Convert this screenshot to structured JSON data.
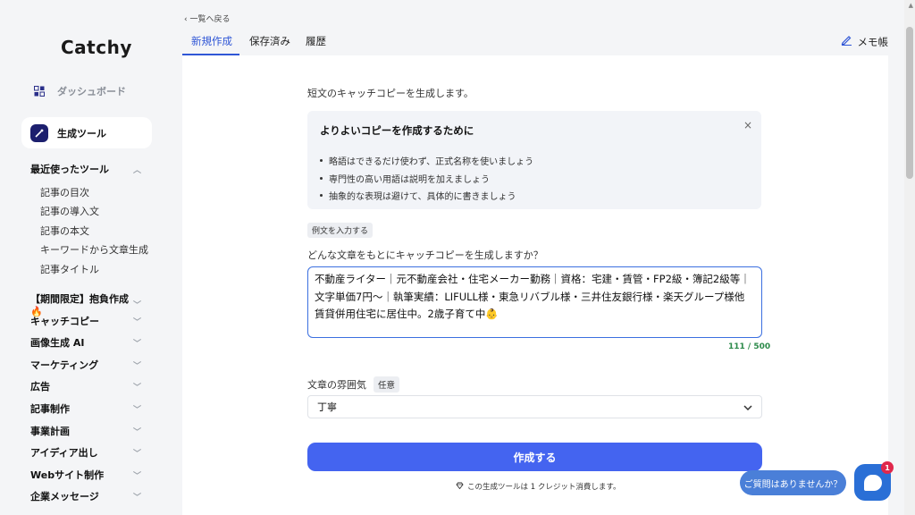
{
  "sidebar": {
    "logo": "Catchy",
    "dashboard": "ダッシュボード",
    "tools": "生成ツール",
    "recent": {
      "label": "最近使ったツール",
      "items": [
        "記事の目次",
        "記事の導入文",
        "記事の本文",
        "キーワードから文章生成",
        "記事タイトル"
      ]
    },
    "sections": [
      "【期間限定】抱負作成🔥",
      "キャッチコピー",
      "画像生成 AI",
      "マーケティング",
      "広告",
      "記事制作",
      "事業計画",
      "アイディア出し",
      "Webサイト制作",
      "企業メッセージ"
    ]
  },
  "header": {
    "back": "‹ 一覧へ戻る",
    "tabs": [
      "新規作成",
      "保存済み",
      "履歴"
    ],
    "memo": "メモ帳"
  },
  "form": {
    "intro": "短文のキャッチコピーを生成します。",
    "tips": {
      "title": "よりよいコピーを作成するために",
      "close": "×",
      "items": [
        "略語はできるだけ使わず、正式名称を使いましょう",
        "専門性の高い用語は説明を加えましょう",
        "抽象的な表現は避けて、具体的に書きましょう"
      ]
    },
    "example_button": "例文を入力する",
    "question": "どんな文章をもとにキャッチコピーを生成しますか？",
    "input_value": "不動産ライター｜元不動産会社・住宅メーカー勤務｜資格：宅建・賃管・FP2級・簿記2級等｜文字単価7円〜｜執筆実績：LIFULL様・東急リバブル様・三井住友銀行様・楽天グループ様他 賃貸併用住宅に居住中。2歳子育て中👶",
    "counter": "111 / 500",
    "mood_label": "文章の雰囲気",
    "mood_optional": "任意",
    "mood_value": "丁寧",
    "submit": "作成する",
    "credit_note": "この生成ツールは 1 クレジット消費します。"
  },
  "chat": {
    "bubble": "ご質問はありませんか？",
    "badge": "1"
  },
  "colors": {
    "accent": "#2f56d6",
    "button": "#4464f0",
    "counter": "#2c8a4a",
    "badge": "#e0284c"
  }
}
